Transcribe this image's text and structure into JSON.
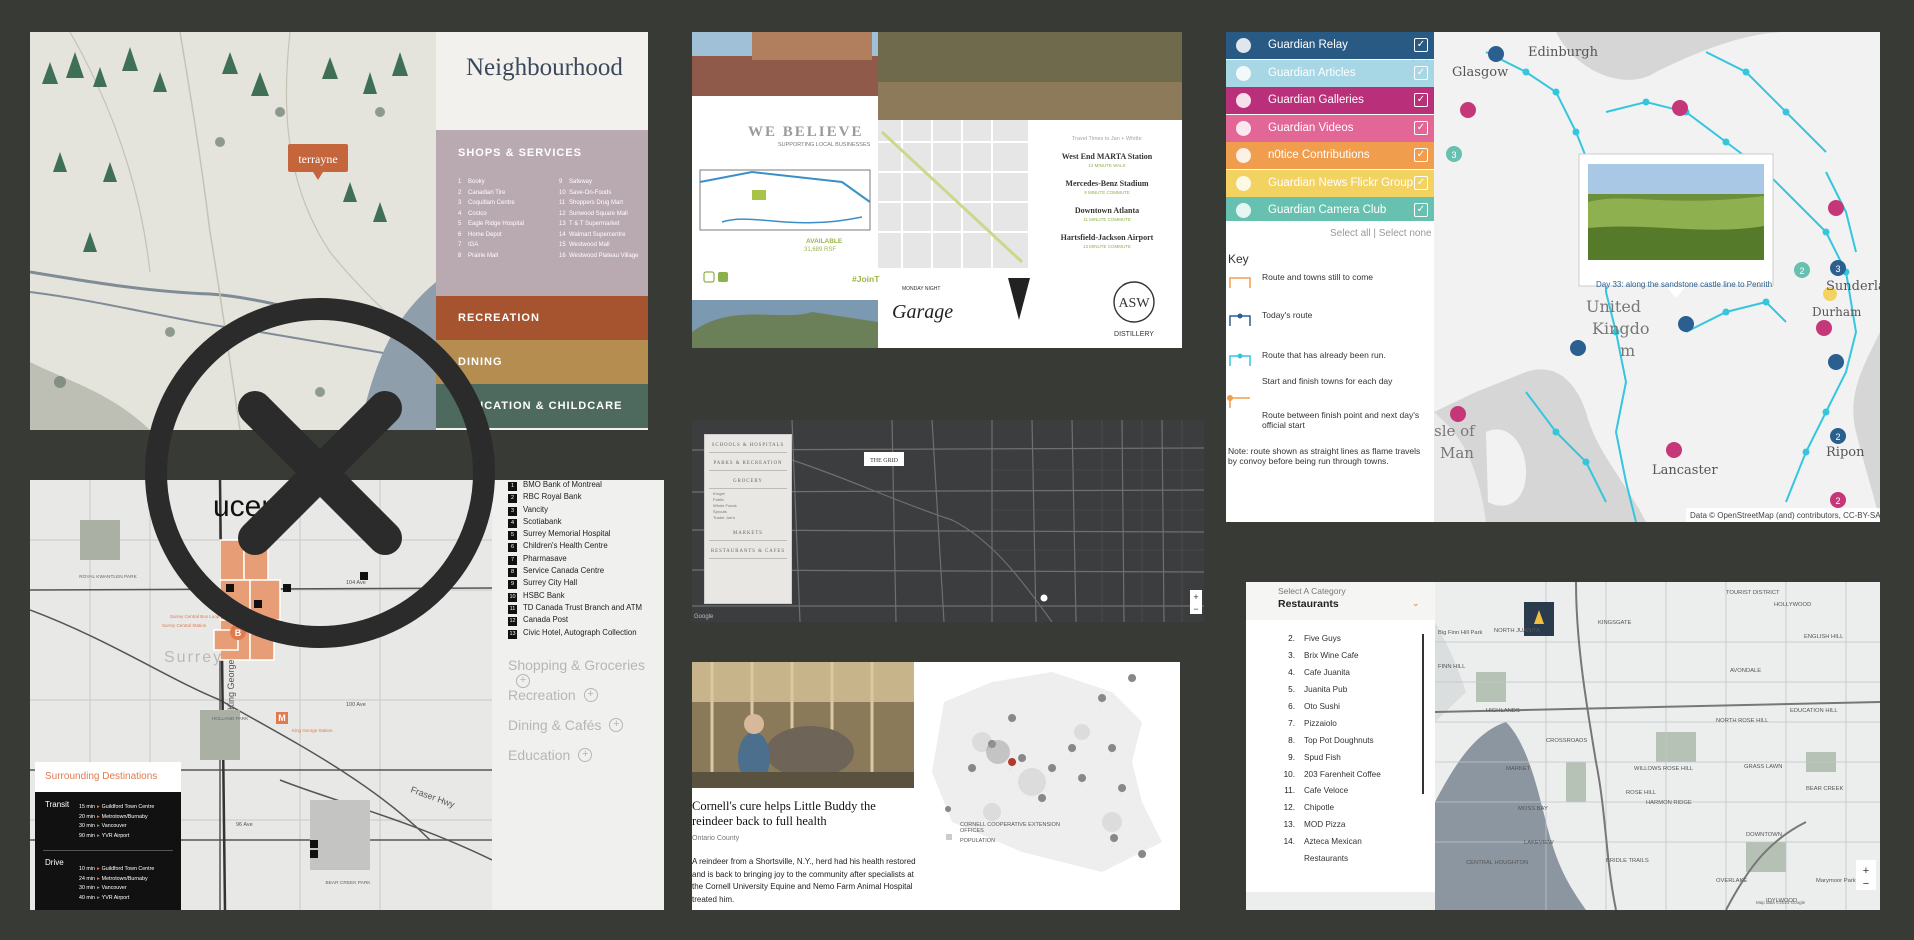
{
  "card1": {
    "title": "Neighbourhood",
    "logo": "terrayne",
    "shops_heading": "SHOPS & SERVICES",
    "shops_left": [
      {
        "n": "1",
        "t": "Booky"
      },
      {
        "n": "2",
        "t": "Canadian Tire"
      },
      {
        "n": "3",
        "t": "Coquitlam Centre"
      },
      {
        "n": "4",
        "t": "Costco"
      },
      {
        "n": "5",
        "t": "Eagle Ridge Hospital"
      },
      {
        "n": "6",
        "t": "Home Depot"
      },
      {
        "n": "7",
        "t": "IGA"
      },
      {
        "n": "8",
        "t": "Prairie Mall"
      }
    ],
    "shops_right": [
      {
        "n": "9",
        "t": "Safeway"
      },
      {
        "n": "10",
        "t": "Save-On-Foods"
      },
      {
        "n": "11",
        "t": "Shoppers Drug Mart"
      },
      {
        "n": "12",
        "t": "Sunwood Square Mall"
      },
      {
        "n": "13",
        "t": "T & T Supermarket"
      },
      {
        "n": "14",
        "t": "Walmart Supercentre"
      },
      {
        "n": "15",
        "t": "Westwood Mall"
      },
      {
        "n": "16",
        "t": "Westwood Plateau Village"
      }
    ],
    "band_recreation": "RECREATION",
    "band_dining": "DINING",
    "band_education": "EDUCATION & CHILDCARE",
    "colors": {
      "shops": "#b9a9b1",
      "recreation": "#a6532f",
      "dining": "#b58d51",
      "education": "#4e6a5f"
    }
  },
  "card2": {
    "headline": "WE BELIEVE",
    "subline": "SUPPORTING LOCAL BUSINESSES",
    "available": "AVAILABLE",
    "available_sf": "31,689 RSF",
    "hashtag": "#JoinT",
    "travel_heading": "Travel Times to Jan + Whitte",
    "destinations": [
      {
        "name": "West End MARTA Station",
        "time": "12 MINUTE WALK"
      },
      {
        "name": "Mercedes-Benz Stadium",
        "time": "9 MINUTE COMMUTE"
      },
      {
        "name": "Downtown Atlanta",
        "time": "11 MINUTE COMMUTE"
      },
      {
        "name": "Hartsfield-Jackson Airport",
        "time": "13 MINUTE COMMUTE"
      }
    ],
    "logos": {
      "garage": "Garage",
      "garage_small": "MONDAY NIGHT",
      "asw": "ASW",
      "asw_sub": "DISTILLERY"
    }
  },
  "card3": {
    "layers": [
      {
        "label": "Guardian Relay",
        "color": "#285a84"
      },
      {
        "label": "Guardian Articles",
        "color": "#a7d6e5"
      },
      {
        "label": "Guardian Galleries",
        "color": "#b92f79"
      },
      {
        "label": "Guardian Videos",
        "color": "#e26796"
      },
      {
        "label": "n0tice Contributions",
        "color": "#f09d4e"
      },
      {
        "label": "Guardian News Flickr Group",
        "color": "#f2d361"
      },
      {
        "label": "Guardian Camera Club",
        "color": "#68c1b0"
      }
    ],
    "select_all": "Select all",
    "separator": "|",
    "select_none": "Select none",
    "key_title": "Key",
    "key_items": [
      "Route and towns still to come",
      "Today's route",
      "Route that has already been run.",
      "Start and finish towns for each day",
      "Route between finish point and next day's",
      "official start"
    ],
    "note_line1": "Note: route shown as straight lines as flame travels",
    "note_line2": "by convoy before being run through towns.",
    "popup_caption": "Day 33: along the sandstone castle line to Penrith",
    "places": {
      "edinburgh": "Edinburgh",
      "glasgow": "Glasgow",
      "uk1": "United",
      "uk2": "Kingdo",
      "uk3": "m",
      "isle1": "sle of",
      "isle2": "Man",
      "lancaster": "Lancaster",
      "ripon": "Ripon",
      "sunderland": "Sunderla",
      "durham": "Durham"
    },
    "attribution": "Data © OpenStreetMap (and) contributors, CC-BY-SA",
    "zoom_in": "+",
    "zoom_out": "−"
  },
  "card4": {
    "sidebar_items": [
      "SCHOOLS & HOSPITALS",
      "PARKS & RECREATION",
      "GROCERY",
      "MARKETS",
      "RESTAURANTS & CAFES"
    ],
    "sub_items": [
      "Kroger",
      "Publix",
      "Whole Foods",
      "Sprouts",
      "Trader Joe's"
    ],
    "map_label": "THE GRID",
    "google": "Google"
  },
  "card5": {
    "title_fragment": "ucent",
    "place_surrey": "Surrey",
    "place_royal": "ROYAL KWANTLEN PARK",
    "place_holland": "HOLLAND PARK",
    "street_king": "King George",
    "street_fraser": "Fraser Hwy",
    "street_104": "104 Ave",
    "street_100": "100 Ave",
    "street_96": "96 Ave",
    "label_bus": "Surrey Central Bus Loop",
    "label_station": "King George Station",
    "label_surrey_central": "Surrey Central Station",
    "place_bear_creek": "BEAR CREEK PARK",
    "list": [
      {
        "n": "1",
        "t": "BMO Bank of Montreal"
      },
      {
        "n": "2",
        "t": "RBC Royal Bank"
      },
      {
        "n": "3",
        "t": "Vancity"
      },
      {
        "n": "4",
        "t": "Scotiabank"
      },
      {
        "n": "5",
        "t": "Surrey Memorial Hospital"
      },
      {
        "n": "6",
        "t": "Children's Health Centre"
      },
      {
        "n": "7",
        "t": "Pharmasave"
      },
      {
        "n": "8",
        "t": "Service Canada Centre"
      },
      {
        "n": "9",
        "t": "Surrey City Hall"
      },
      {
        "n": "10",
        "t": "HSBC Bank"
      },
      {
        "n": "11",
        "t": "TD Canada Trust Branch and ATM"
      },
      {
        "n": "12",
        "t": "Canada Post"
      },
      {
        "n": "13",
        "t": "Civic Hotel, Autograph Collection"
      }
    ],
    "categories": [
      "Shopping & Groceries",
      "Recreation",
      "Dining & Cafés",
      "Education"
    ],
    "dest_title": "Surrounding Destinations",
    "transit_label": "Transit",
    "drive_label": "Drive",
    "transit": [
      {
        "time": "15 min",
        "place": "Guildford Town Centre"
      },
      {
        "time": "20 min",
        "place": "Metrotown/Burnaby"
      },
      {
        "time": "30 min",
        "place": "Vancouver"
      },
      {
        "time": "90 min",
        "place": "YVR Airport"
      }
    ],
    "drive": [
      {
        "time": "10 min",
        "place": "Guildford Town Centre"
      },
      {
        "time": "24 min",
        "place": "Metrotown/Burnaby"
      },
      {
        "time": "30 min",
        "place": "Vancouver"
      },
      {
        "time": "40 min",
        "place": "YVR Airport"
      }
    ]
  },
  "card6": {
    "headline_line1": "Cornell's cure helps Little Buddy the",
    "headline_line2": "reindeer back to full health",
    "county": "Ontario County",
    "body_line1": "A reindeer from a Shortsville, N.Y., herd had his health restored",
    "body_line2": "and is back to bringing joy to the community after specialists at",
    "body_line3": "the Cornell University Equine and Nemo Farm Animal Hospital",
    "body_line4": "treated him.",
    "legend_offices_1": "CORNELL COOPERATIVE EXTENSION",
    "legend_offices_2": "OFFICES",
    "legend_population": "POPULATION"
  },
  "card7": {
    "select_label": "Select A Category",
    "selected": "Restaurants",
    "items": [
      {
        "n": "2.",
        "t": "Five Guys"
      },
      {
        "n": "3.",
        "t": "Brix Wine Cafe"
      },
      {
        "n": "4.",
        "t": "Cafe Juanita"
      },
      {
        "n": "5.",
        "t": "Juanita Pub"
      },
      {
        "n": "6.",
        "t": "Oto Sushi"
      },
      {
        "n": "7.",
        "t": "Pizzaiolo"
      },
      {
        "n": "8.",
        "t": "Top Pot Doughnuts"
      },
      {
        "n": "9.",
        "t": "Spud Fish"
      },
      {
        "n": "10.",
        "t": "203 Farenheit Coffee"
      },
      {
        "n": "11.",
        "t": "Cafe Veloce"
      },
      {
        "n": "12.",
        "t": "Chipotle"
      },
      {
        "n": "13.",
        "t": "MOD Pizza"
      },
      {
        "n": "14.",
        "t": "Azteca Mexican"
      },
      {
        "n": "",
        "t": "Restaurants"
      }
    ],
    "places": {
      "tourist": "TOURIST DISTRICT",
      "hollywood": "HOLLYWOOD",
      "kingsgate": "KINGSGATE",
      "juanita": "NORTH JUANITA",
      "english": "ENGLISH HILL",
      "finn": "FINN HILL",
      "market": "MARKET",
      "moss": "MOSS BAY",
      "lakeview": "LAKEVIEW",
      "rose": "ROSE HILL",
      "downtown": "DOWNTOWN",
      "bridle": "BRIDLE TRAILS",
      "overlake": "OVERLAKE",
      "bearcreek": "BEAR CREEK",
      "avondale": "AVONDALE",
      "grass": "GRASS LAWN",
      "education": "EDUCATION HILL",
      "highlands": "HIGHLANDS",
      "crossroads": "CROSSROADS",
      "central": "CENTRAL HOUGHTON",
      "willows": "WILLOWS ROSE HILL",
      "harmon": "HARMON RIDGE",
      "north_rose": "NORTH ROSE HILL",
      "idylwood": "IDYLWOOD",
      "bigfinn": "Big Finn Hill Park",
      "redmond": "Marymoor Park"
    },
    "zoom_in": "+",
    "zoom_out": "−",
    "footer": "Map data ©2023 Google"
  }
}
